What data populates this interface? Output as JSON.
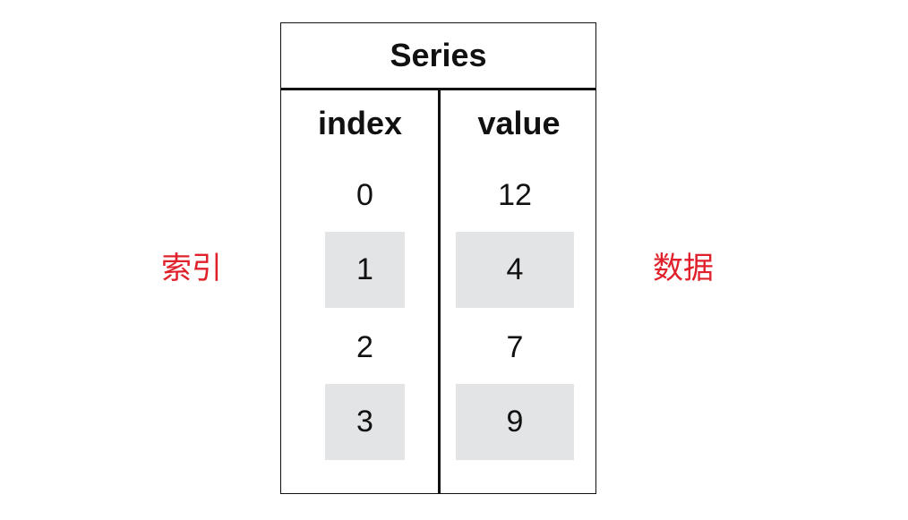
{
  "labels": {
    "left": "索引",
    "right": "数据"
  },
  "series": {
    "title": "Series",
    "headers": {
      "index": "index",
      "value": "value"
    },
    "rows": [
      {
        "index": "0",
        "value": "12"
      },
      {
        "index": "1",
        "value": "4"
      },
      {
        "index": "2",
        "value": "7"
      },
      {
        "index": "3",
        "value": "9"
      }
    ]
  },
  "colors": {
    "label": "#e0202a",
    "border": "#111111",
    "shaded_row": "#e3e4e6"
  }
}
